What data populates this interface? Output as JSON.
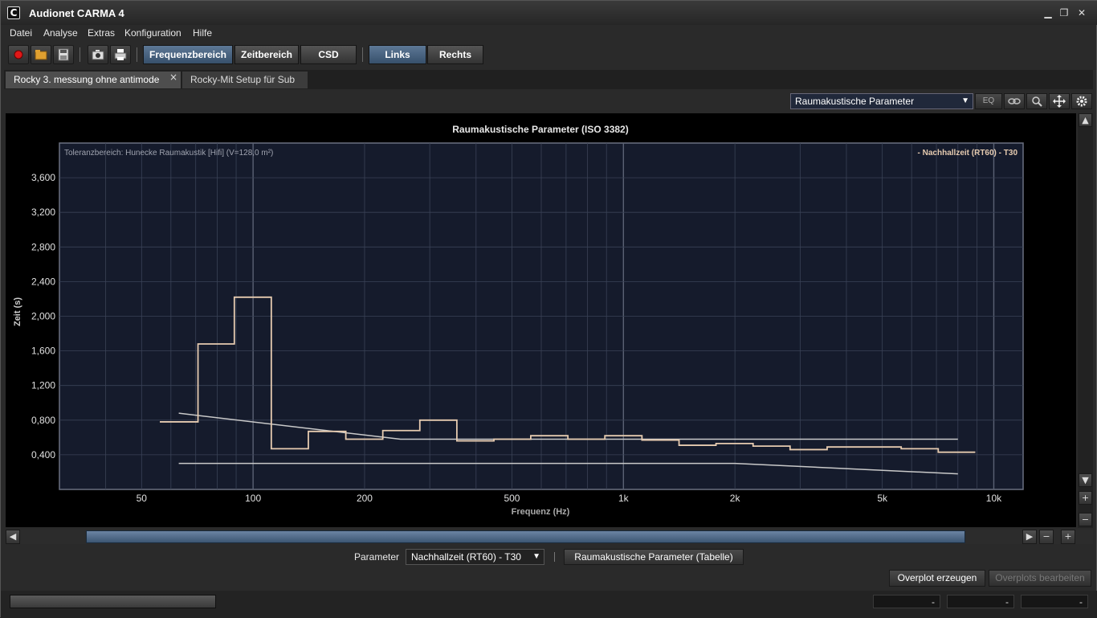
{
  "window": {
    "logo_letter": "C",
    "title": "Audionet CARMA 4",
    "minimize_icon": "minimize-icon",
    "restore_icon": "restore-icon",
    "close_icon": "close-icon"
  },
  "menu": {
    "items": [
      "Datei",
      "Analyse",
      "Extras",
      "Konfiguration",
      "Hilfe"
    ]
  },
  "toolbar": {
    "icons": [
      "record-icon",
      "open-folder-icon",
      "save-icon",
      "camera-icon",
      "print-icon"
    ],
    "view_buttons": [
      "Frequenzbereich",
      "Zeitbereich",
      "CSD"
    ],
    "active_view": "Frequenzbereich",
    "channel_buttons": [
      "Links",
      "Rechts"
    ],
    "active_channel": "Links"
  },
  "tabs": {
    "items": [
      {
        "label": "Rocky 3. messung ohne antimode",
        "active": true,
        "close": "×"
      },
      {
        "label": "Rocky-Mit Setup für Sub",
        "active": false
      }
    ]
  },
  "chart_header": {
    "view_select_value": "Raumakustische Parameter",
    "eq_label": "EQ",
    "icons": [
      "link-icon",
      "zoom-icon",
      "move-icon",
      "gear-icon"
    ]
  },
  "chart_data": {
    "type": "line",
    "title": "Raumakustische Parameter (ISO 3382)",
    "tolerance_label": "Toleranzbereich: Hunecke Raumakustik [Hifi] (V=128,0 m²)",
    "legend": "- Nachhallzeit (RT60) - T30",
    "legend_position": "top-right",
    "xlabel": "Frequenz (Hz)",
    "ylabel": "Zeit (s)",
    "x_scale": "log",
    "xlim": [
      30,
      12000
    ],
    "ylim": [
      0,
      4.0
    ],
    "x_ticks": [
      50,
      100,
      200,
      500,
      1000,
      2000,
      5000,
      10000
    ],
    "x_tick_labels": [
      "50",
      "100",
      "200",
      "500",
      "1k",
      "2k",
      "5k",
      "10k"
    ],
    "y_ticks": [
      0.4,
      0.8,
      1.2,
      1.6,
      2.0,
      2.4,
      2.8,
      3.2,
      3.6
    ],
    "y_tick_labels": [
      "0,400",
      "0,800",
      "1,200",
      "1,600",
      "2,000",
      "2,400",
      "2,800",
      "3,200",
      "3,600"
    ],
    "grid": true,
    "colors": {
      "background": "#151b2c",
      "measured": "#e6cbb0",
      "tolerance": "#c9c9c9",
      "grid": "#3a4256"
    },
    "series": [
      {
        "name": "Nachhallzeit (RT60) - T30",
        "style": "step",
        "bands": [
          {
            "lo": 56,
            "hi": 71,
            "value": 0.78
          },
          {
            "lo": 71,
            "hi": 89,
            "value": 1.68
          },
          {
            "lo": 89,
            "hi": 112,
            "value": 2.22
          },
          {
            "lo": 112,
            "hi": 141,
            "value": 0.47
          },
          {
            "lo": 141,
            "hi": 178,
            "value": 0.67
          },
          {
            "lo": 178,
            "hi": 224,
            "value": 0.58
          },
          {
            "lo": 224,
            "hi": 282,
            "value": 0.68
          },
          {
            "lo": 282,
            "hi": 355,
            "value": 0.8
          },
          {
            "lo": 355,
            "hi": 447,
            "value": 0.56
          },
          {
            "lo": 447,
            "hi": 562,
            "value": 0.58
          },
          {
            "lo": 562,
            "hi": 708,
            "value": 0.62
          },
          {
            "lo": 708,
            "hi": 891,
            "value": 0.58
          },
          {
            "lo": 891,
            "hi": 1122,
            "value": 0.62
          },
          {
            "lo": 1122,
            "hi": 1413,
            "value": 0.57
          },
          {
            "lo": 1413,
            "hi": 1778,
            "value": 0.51
          },
          {
            "lo": 1778,
            "hi": 2239,
            "value": 0.53
          },
          {
            "lo": 2239,
            "hi": 2818,
            "value": 0.5
          },
          {
            "lo": 2818,
            "hi": 3548,
            "value": 0.46
          },
          {
            "lo": 3548,
            "hi": 4467,
            "value": 0.49
          },
          {
            "lo": 4467,
            "hi": 5623,
            "value": 0.49
          },
          {
            "lo": 5623,
            "hi": 7079,
            "value": 0.47
          },
          {
            "lo": 7079,
            "hi": 8913,
            "value": 0.43
          }
        ]
      },
      {
        "name": "Toleranz oben",
        "style": "line",
        "x": [
          63,
          250,
          8000
        ],
        "y": [
          0.88,
          0.58,
          0.58
        ]
      },
      {
        "name": "Toleranz unten",
        "style": "line",
        "x": [
          63,
          2000,
          8000
        ],
        "y": [
          0.3,
          0.3,
          0.18
        ]
      }
    ]
  },
  "vscroll": {
    "up": "▲",
    "down": "▼",
    "plus": "+",
    "minus": "−"
  },
  "hscroll": {
    "left": "◀",
    "right": "▶",
    "minus": "−",
    "plus": "+"
  },
  "param_bar": {
    "label": "Parameter",
    "select_value": "Nachhallzeit (RT60) - T30",
    "table_button": "Raumakustische Parameter (Tabelle)"
  },
  "overplot": {
    "create_button": "Overplot erzeugen",
    "edit_button": "Overplots bearbeiten"
  },
  "status": {
    "fields": [
      "-",
      "-",
      "-"
    ]
  }
}
